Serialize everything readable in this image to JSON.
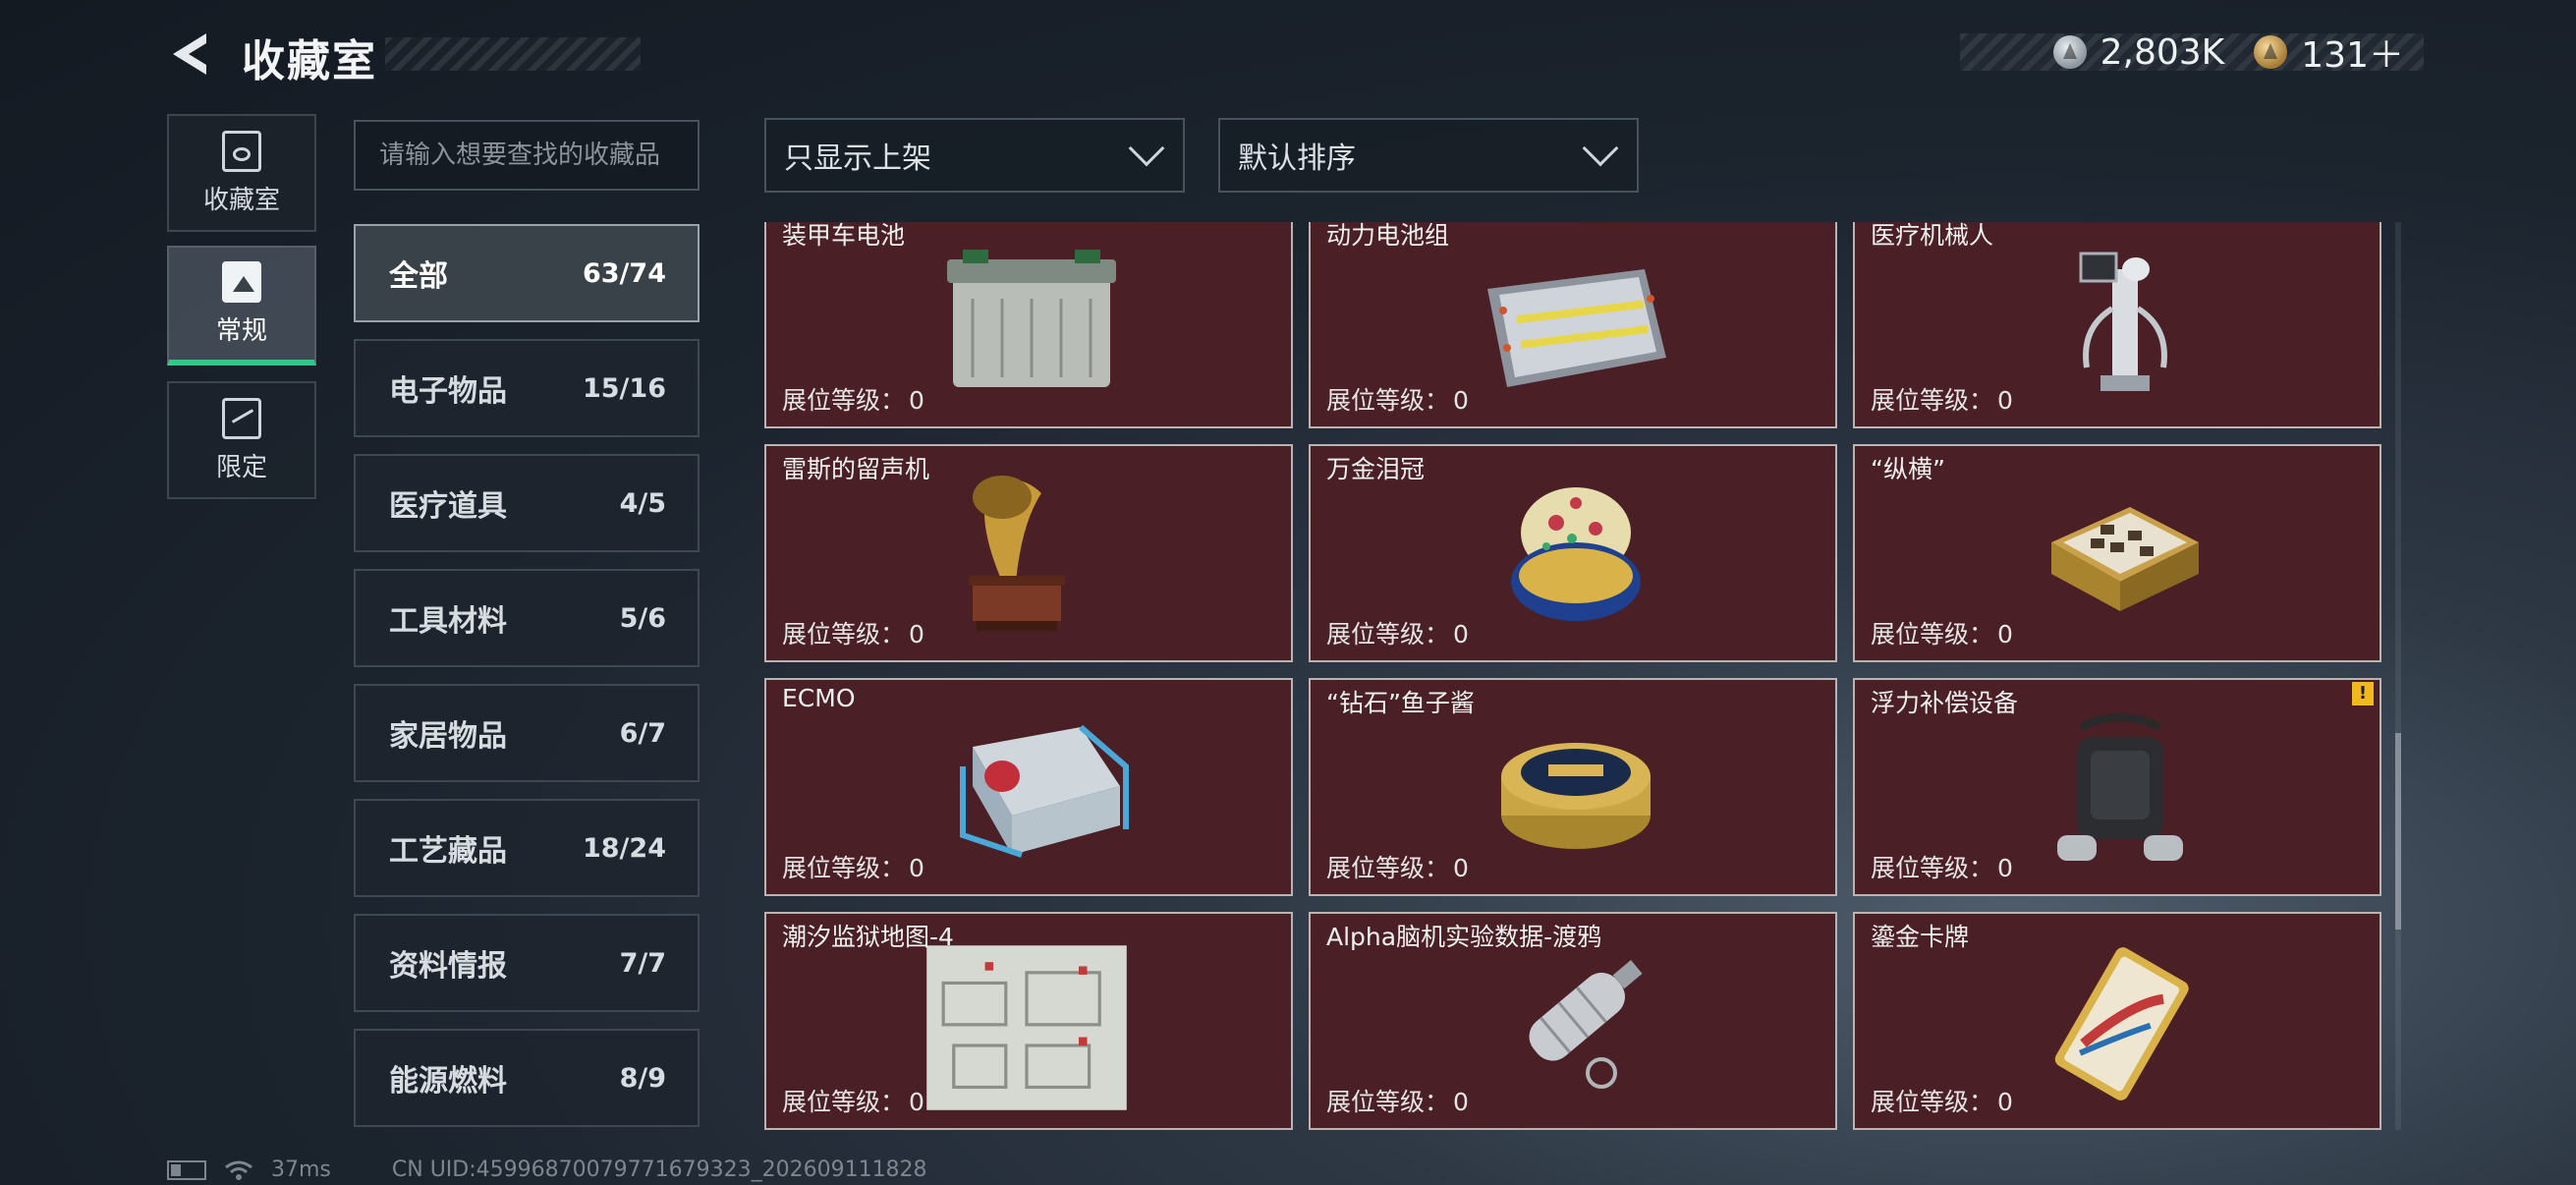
{
  "header": {
    "title": "收藏室",
    "currency": [
      {
        "icon": "silver-coin-icon",
        "value": "2,803K"
      },
      {
        "icon": "gold-coin-icon",
        "value": "131＋"
      }
    ]
  },
  "rail": {
    "tabs": [
      {
        "label": "收藏室",
        "icon": "collection-room-icon",
        "active": false
      },
      {
        "label": "常规",
        "icon": "regular-icon",
        "active": true
      },
      {
        "label": "限定",
        "icon": "limited-icon",
        "active": false
      }
    ]
  },
  "search": {
    "placeholder": "请输入想要查找的收藏品"
  },
  "subcategories": [
    {
      "label": "全部",
      "count": "63/74",
      "active": true
    },
    {
      "label": "电子物品",
      "count": "15/16",
      "active": false
    },
    {
      "label": "医疗道具",
      "count": "4/5",
      "active": false
    },
    {
      "label": "工具材料",
      "count": "5/6",
      "active": false
    },
    {
      "label": "家居物品",
      "count": "6/7",
      "active": false
    },
    {
      "label": "工艺藏品",
      "count": "18/24",
      "active": false
    },
    {
      "label": "资料情报",
      "count": "7/7",
      "active": false
    },
    {
      "label": "能源燃料",
      "count": "8/9",
      "active": false
    }
  ],
  "filters": {
    "shelf_filter": "只显示上架",
    "sort": "默认排序"
  },
  "level_label": "展位等级：",
  "items": [
    {
      "name": "装甲车电池",
      "level": "0",
      "art": "battery-art"
    },
    {
      "name": "动力电池组",
      "level": "0",
      "art": "battery-pack-art"
    },
    {
      "name": "医疗机械人",
      "level": "0",
      "art": "robot-art"
    },
    {
      "name": "雷斯的留声机",
      "level": "0",
      "art": "gramophone-art"
    },
    {
      "name": "万金泪冠",
      "level": "0",
      "art": "egg-art"
    },
    {
      "name": "“纵横”",
      "level": "0",
      "art": "chess-art"
    },
    {
      "name": "ECMO",
      "level": "0",
      "art": "ecmo-art"
    },
    {
      "name": "“钻石”鱼子酱",
      "level": "0",
      "art": "caviar-art"
    },
    {
      "name": "浮力补偿设备",
      "level": "0",
      "art": "bcd-art",
      "warning": "!"
    },
    {
      "name": "潮汐监狱地图-4",
      "level": "0",
      "art": "map-art"
    },
    {
      "name": "Alpha脑机实验数据-渡鸦",
      "level": "0",
      "art": "capsule-art"
    },
    {
      "name": "鎏金卡牌",
      "level": "0",
      "art": "card-art"
    }
  ],
  "footer": {
    "ping": "37ms",
    "uid": "CN UID:45996870079771679323_202609111828"
  },
  "colors": {
    "card_bg": "#4a1f25",
    "active_tab_accent": "#35c48a",
    "warning": "#f2b81f"
  }
}
